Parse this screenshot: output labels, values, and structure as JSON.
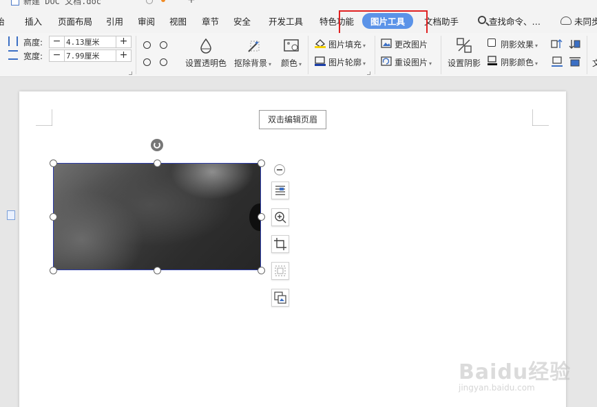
{
  "window": {
    "doc_title": "新建 DOC 文档.doc"
  },
  "tabs": [
    {
      "id": "start",
      "label": "开始",
      "visible": "始"
    },
    {
      "id": "insert",
      "label": "插入"
    },
    {
      "id": "layout",
      "label": "页面布局"
    },
    {
      "id": "references",
      "label": "引用"
    },
    {
      "id": "review",
      "label": "审阅"
    },
    {
      "id": "view",
      "label": "视图"
    },
    {
      "id": "chapter",
      "label": "章节"
    },
    {
      "id": "security",
      "label": "安全"
    },
    {
      "id": "developer",
      "label": "开发工具"
    },
    {
      "id": "features",
      "label": "特色功能"
    },
    {
      "id": "picture_tools",
      "label": "图片工具",
      "active": true
    },
    {
      "id": "doc_helper",
      "label": "文档助手"
    }
  ],
  "search": {
    "label": "查找命令、…"
  },
  "sync": {
    "label": "未同步"
  },
  "ribbon": {
    "height_label": "高度:",
    "height_value": "4.13厘米",
    "width_label": "宽度:",
    "width_value": "7.99厘米",
    "minus": "−",
    "plus": "+",
    "set_transparent": "设置透明色",
    "remove_bg": "抠除背景",
    "color": "颜色",
    "picture_fill": "图片填充",
    "picture_outline": "图片轮廓",
    "change_picture": "更改图片",
    "reset_picture": "重设图片",
    "set_shadow": "设置阴影",
    "shadow_effect": "阴影效果",
    "shadow_color": "阴影颜色",
    "overflow_text": "文",
    "caret": "▾"
  },
  "document": {
    "header_button": "双击编辑页眉"
  },
  "watermark": {
    "logo": "Baidu经验",
    "url": "jingyan.baidu.com"
  },
  "colors": {
    "accent": "#5b93e8",
    "highlight": "#e02020",
    "selection_border": "#2a3aa8"
  }
}
